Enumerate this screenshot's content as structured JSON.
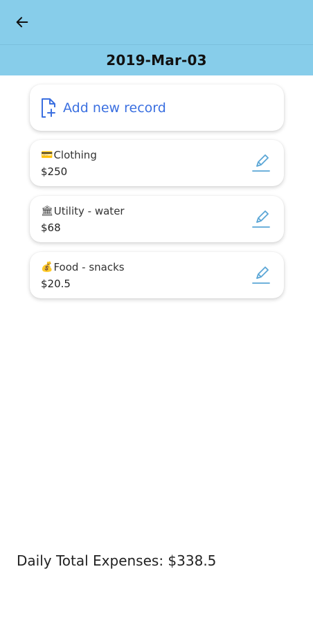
{
  "header": {
    "back_icon": "arrow-left-icon",
    "date": "2019-Mar-03"
  },
  "add_record": {
    "icon": "file-plus-icon",
    "label": "Add new record"
  },
  "records": [
    {
      "emoji": "💳",
      "title": "Clothing",
      "amount": "$250",
      "edit_icon": "pencil-icon"
    },
    {
      "emoji": "🏛",
      "title": "Utility - water",
      "amount": "$68",
      "edit_icon": "pencil-icon"
    },
    {
      "emoji": "💰",
      "title": "Food - snacks",
      "amount": "$20.5",
      "edit_icon": "pencil-icon"
    }
  ],
  "footer": {
    "total_label": "Daily Total Expenses: $338.5"
  },
  "colors": {
    "header_bg": "#87cdea",
    "accent_blue": "#3a6fe0",
    "edit_icon": "#5aa6d6"
  }
}
